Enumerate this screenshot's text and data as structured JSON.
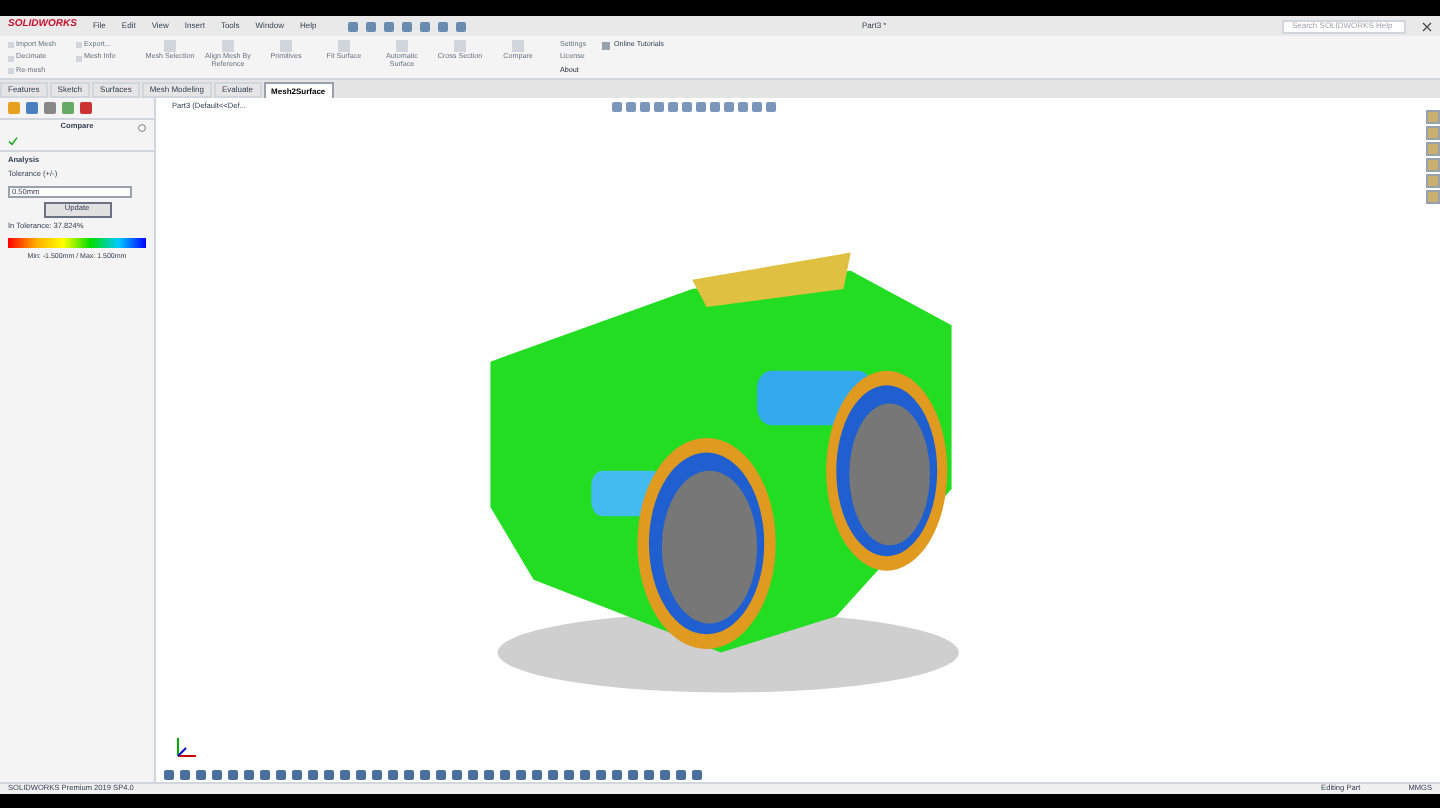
{
  "app": {
    "logo": "SOLIDWORKS",
    "menu": [
      "File",
      "Edit",
      "View",
      "Insert",
      "Tools",
      "Window",
      "Help"
    ],
    "document_title": "Part3 *",
    "search": {
      "placeholder": "Search SOLIDWORKS Help"
    }
  },
  "ribbon": {
    "small_buttons": [
      {
        "label": "Import Mesh"
      },
      {
        "label": "Export..."
      },
      {
        "label": "Decimate"
      },
      {
        "label": "Mesh Info"
      },
      {
        "label": "Re-mesh"
      }
    ],
    "large_buttons": [
      {
        "label": "Mesh Selection"
      },
      {
        "label": "Align Mesh By Reference"
      },
      {
        "label": "Primitives"
      },
      {
        "label": "Fit Surface"
      },
      {
        "label": "Automatic Surface"
      },
      {
        "label": "Cross Section"
      },
      {
        "label": "Compare"
      }
    ],
    "info_buttons": [
      {
        "label": "Settings"
      },
      {
        "label": "License"
      },
      {
        "label": "About"
      }
    ],
    "tutorials": "Online Tutorials"
  },
  "tabs": [
    {
      "label": "Features",
      "selected": false
    },
    {
      "label": "Sketch",
      "selected": false
    },
    {
      "label": "Surfaces",
      "selected": false
    },
    {
      "label": "Mesh Modeling",
      "selected": false
    },
    {
      "label": "Evaluate",
      "selected": false
    },
    {
      "label": "Mesh2Surface",
      "selected": true
    }
  ],
  "panel": {
    "title": "Compare",
    "section": "Analysis",
    "tolerance_label": "Tolerance (+/-)",
    "tolerance_value": "0.50mm",
    "update_button": "Update",
    "in_tolerance": "In Tolerance: 37.824%",
    "range": "Min: -1.500mm / Max: 1.500mm"
  },
  "tree_path": "Part3 (Default<<Def...",
  "status_bar": {
    "product": "SOLIDWORKS Premium 2019 SP4.0",
    "mode": "Editing Part",
    "units": "MMGS"
  }
}
